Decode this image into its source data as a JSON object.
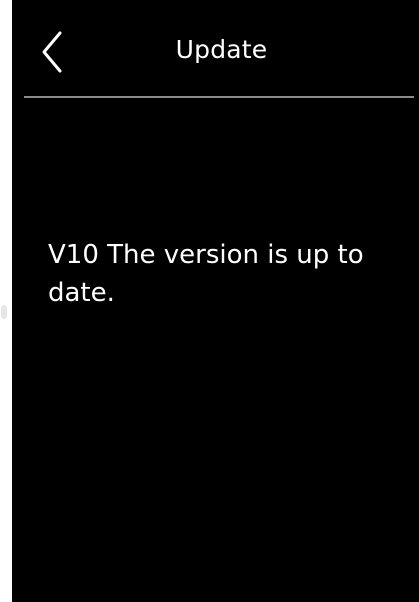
{
  "header": {
    "title": "Update"
  },
  "content": {
    "message": "V10 The version is up to date."
  },
  "icons": {
    "back": "chevron-left-icon"
  },
  "colors": {
    "background": "#000000",
    "text": "#ffffff",
    "divider": "#8a8a8a"
  }
}
